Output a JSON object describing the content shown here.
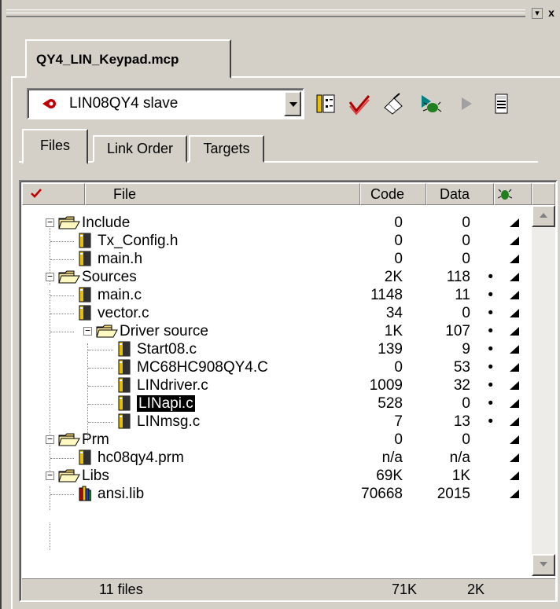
{
  "window": {
    "minimize_glyph": "▾",
    "close_glyph": "x"
  },
  "project_tab": {
    "label": "QY4_LIN_Keypad.mcp"
  },
  "target": {
    "selected": "LIN08QY4 slave"
  },
  "toolbar": {
    "icons": [
      "target-settings-icon",
      "check-syntax-icon",
      "compile-icon",
      "debug-icon",
      "run-icon",
      "project-inspector-icon"
    ]
  },
  "tabs": [
    {
      "label": "Files",
      "active": true
    },
    {
      "label": "Link Order",
      "active": false
    },
    {
      "label": "Targets",
      "active": false
    }
  ],
  "columns": {
    "file": "File",
    "code": "Code",
    "data": "Data"
  },
  "files": [
    {
      "name": "Include",
      "type": "group",
      "depth": 0,
      "code": "0",
      "data": "0",
      "dot": ""
    },
    {
      "name": "Tx_Config.h",
      "type": "file",
      "depth": 1,
      "code": "0",
      "data": "0",
      "dot": ""
    },
    {
      "name": "main.h",
      "type": "file",
      "depth": 1,
      "code": "0",
      "data": "0",
      "dot": ""
    },
    {
      "name": "Sources",
      "type": "group",
      "depth": 0,
      "code": "2K",
      "data": "118",
      "dot": "•"
    },
    {
      "name": "main.c",
      "type": "file",
      "depth": 1,
      "code": "1148",
      "data": "11",
      "dot": "•"
    },
    {
      "name": "vector.c",
      "type": "file",
      "depth": 1,
      "code": "34",
      "data": "0",
      "dot": "•"
    },
    {
      "name": "Driver source",
      "type": "group",
      "depth": 1,
      "code": "1K",
      "data": "107",
      "dot": "•"
    },
    {
      "name": "Start08.c",
      "type": "file",
      "depth": 2,
      "code": "139",
      "data": "9",
      "dot": "•"
    },
    {
      "name": "MC68HC908QY4.C",
      "type": "file",
      "depth": 2,
      "code": "0",
      "data": "53",
      "dot": "•"
    },
    {
      "name": "LINdriver.c",
      "type": "file",
      "depth": 2,
      "code": "1009",
      "data": "32",
      "dot": "•"
    },
    {
      "name": "LINapi.c",
      "type": "file",
      "depth": 2,
      "code": "528",
      "data": "0",
      "dot": "•",
      "selected": true
    },
    {
      "name": "LINmsg.c",
      "type": "file",
      "depth": 2,
      "code": "7",
      "data": "13",
      "dot": "•"
    },
    {
      "name": "Prm",
      "type": "group",
      "depth": 0,
      "code": "0",
      "data": "0",
      "dot": ""
    },
    {
      "name": "hc08qy4.prm",
      "type": "file",
      "depth": 1,
      "code": "n/a",
      "data": "n/a",
      "dot": ""
    },
    {
      "name": "Libs",
      "type": "group",
      "depth": 0,
      "code": "69K",
      "data": "1K",
      "dot": ""
    },
    {
      "name": "ansi.lib",
      "type": "lib",
      "depth": 1,
      "code": "70668",
      "data": "2015",
      "dot": ""
    }
  ],
  "status": {
    "count": "11 files",
    "code_total": "71K",
    "data_total": "2K"
  }
}
